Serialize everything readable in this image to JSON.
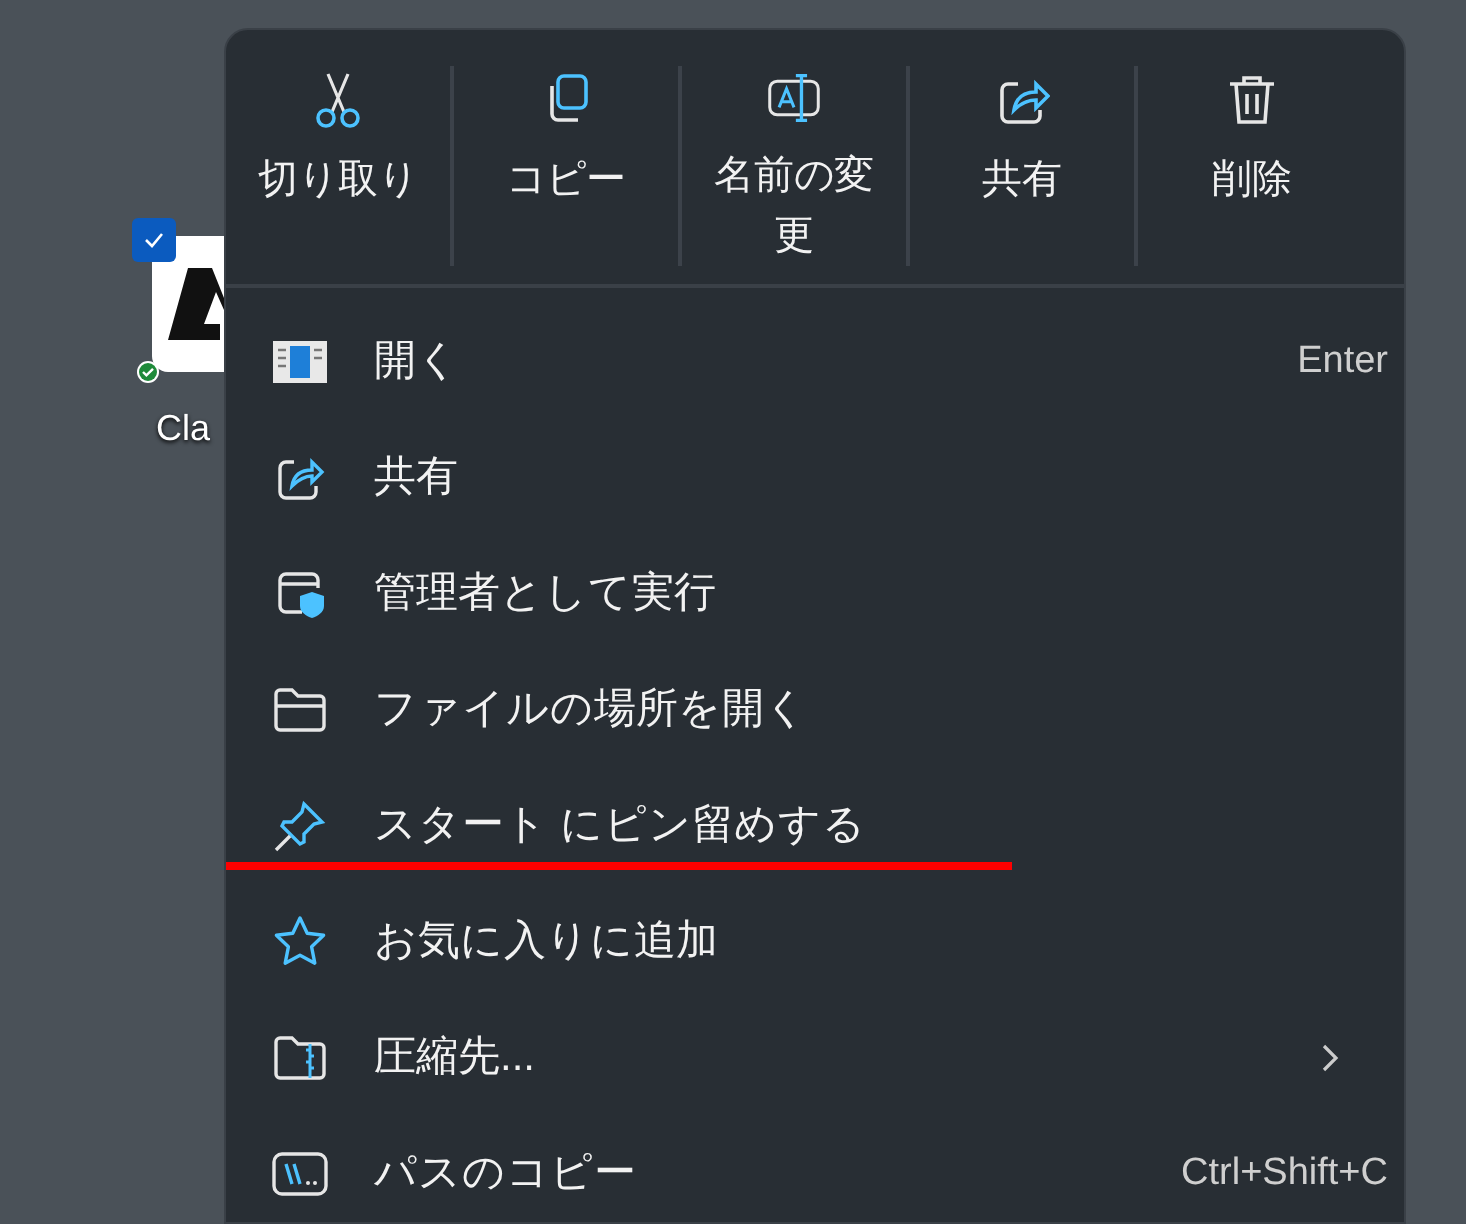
{
  "desktop_icon": {
    "label": "Cla",
    "checked": true
  },
  "toolbar": [
    {
      "label": "切り取り"
    },
    {
      "label": "コピー"
    },
    {
      "label": "名前の変更"
    },
    {
      "label": "共有"
    },
    {
      "label": "削除"
    }
  ],
  "items": [
    {
      "label": "開く",
      "shortcut": "Enter",
      "submenu": false,
      "underlined": false
    },
    {
      "label": "共有",
      "submenu": false,
      "underlined": false
    },
    {
      "label": "管理者として実行",
      "submenu": false,
      "underlined": false
    },
    {
      "label": "ファイルの場所を開く",
      "submenu": false,
      "underlined": false
    },
    {
      "label": "スタート にピン留めする",
      "submenu": false,
      "underlined": true
    },
    {
      "label": "お気に入りに追加",
      "submenu": false,
      "underlined": false
    },
    {
      "label": "圧縮先...",
      "submenu": true,
      "underlined": false
    },
    {
      "label": "パスのコピー",
      "shortcut": "Ctrl+Shift+C",
      "submenu": false,
      "underlined": false
    }
  ]
}
